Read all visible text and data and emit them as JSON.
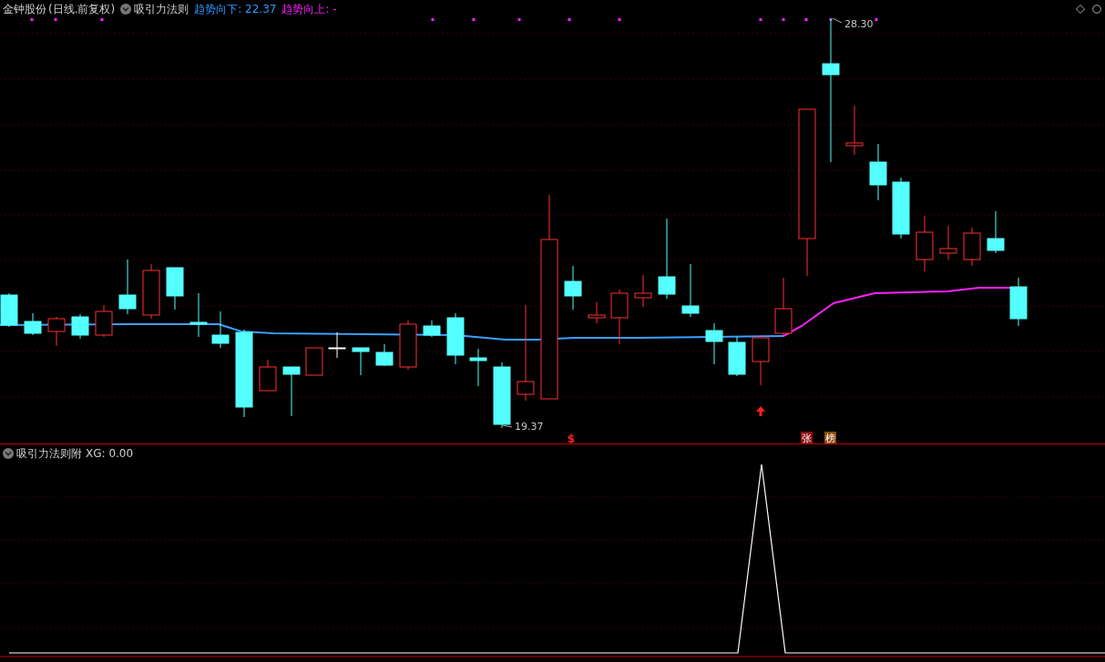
{
  "main_panel": {
    "stock": "金钟股份",
    "period": "(日线.前复权)",
    "indicator": "吸引力法则",
    "trend_down": "趋势向下: 22.37",
    "trend_up": "趋势向上: -",
    "high_label": "28.30",
    "low_label": "19.37",
    "signals": [
      {
        "kind": "text",
        "text": "$",
        "color": "#ff2020"
      },
      {
        "kind": "arrow",
        "color": "#ff2020"
      },
      {
        "kind": "box",
        "text": "张",
        "color": "#8b0f0f"
      },
      {
        "kind": "box",
        "text": "榜",
        "color": "#8b4a10"
      }
    ]
  },
  "sub_panel": {
    "indicator": "吸引力法则附",
    "reading": "XG: 0.00"
  }
}
